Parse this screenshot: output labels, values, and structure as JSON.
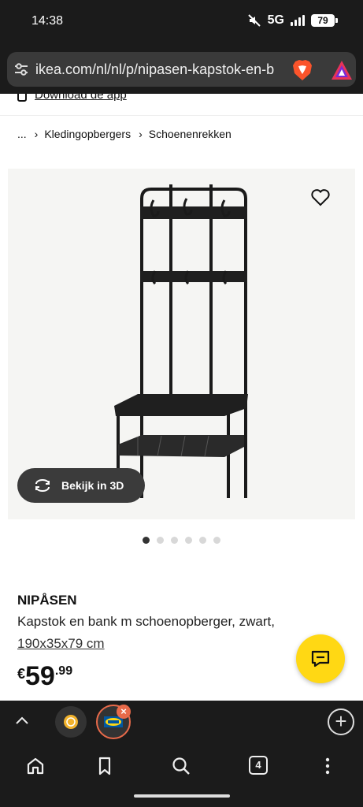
{
  "status": {
    "time": "14:38",
    "network": "5G",
    "battery": "79"
  },
  "browser": {
    "url": "ikea.com/nl/nl/p/nipasen-kapstok-en-b"
  },
  "page": {
    "download_app": "Download de app",
    "breadcrumb": [
      "...",
      "Kledingopbergers",
      "Schoenenrekken"
    ],
    "view_3d_label": "Bekijk in 3D",
    "image_count": 6,
    "image_active_index": 0,
    "product": {
      "name": "NIPÅSEN",
      "description": "Kapstok en bank m schoenopberger, zwart,",
      "size": "190x35x79 cm",
      "price_currency": "€",
      "price_integer": "59",
      "price_decimals": ".99"
    }
  },
  "tabs": {
    "open_count": "4"
  },
  "colors": {
    "accent_yellow": "#ffd814",
    "tab_active_ring": "#e86a4a",
    "ikea_blue": "#0058a3"
  }
}
